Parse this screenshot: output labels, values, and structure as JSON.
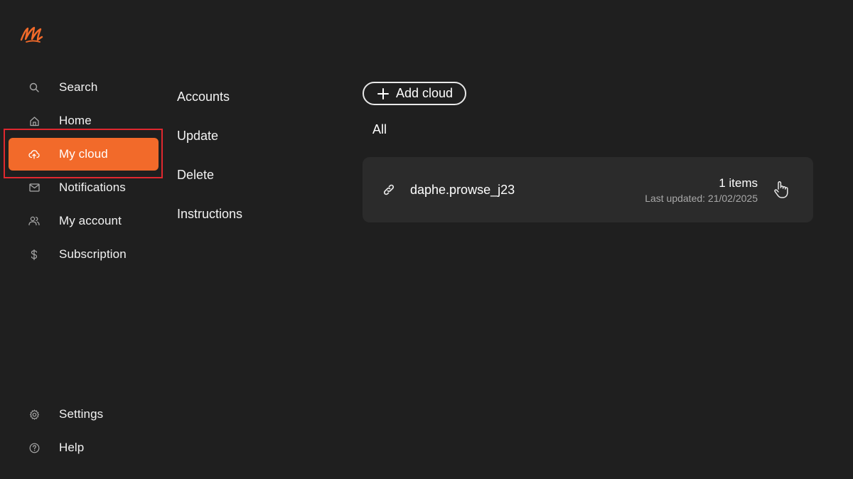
{
  "brand": {
    "logo_icon": "m-logo-icon",
    "accent_color": "#f26a2a"
  },
  "sidebar": {
    "items": [
      {
        "label": "Search",
        "icon": "search-icon"
      },
      {
        "label": "Home",
        "icon": "home-icon"
      },
      {
        "label": "My cloud",
        "icon": "cloud-upload-icon",
        "active": true
      },
      {
        "label": "Notifications",
        "icon": "mail-icon"
      },
      {
        "label": "My account",
        "icon": "users-icon"
      },
      {
        "label": "Subscription",
        "icon": "dollar-icon"
      }
    ],
    "bottom_items": [
      {
        "label": "Settings",
        "icon": "gear-icon"
      },
      {
        "label": "Help",
        "icon": "help-icon"
      }
    ]
  },
  "submenu": {
    "items": [
      "Accounts",
      "Update",
      "Delete",
      "Instructions"
    ]
  },
  "main": {
    "add_cloud_label": "Add cloud",
    "filter_label": "All",
    "clouds": [
      {
        "name": "daphe.prowse_j23",
        "count": "1 items",
        "updated": "Last updated: 21/02/2025"
      }
    ]
  }
}
